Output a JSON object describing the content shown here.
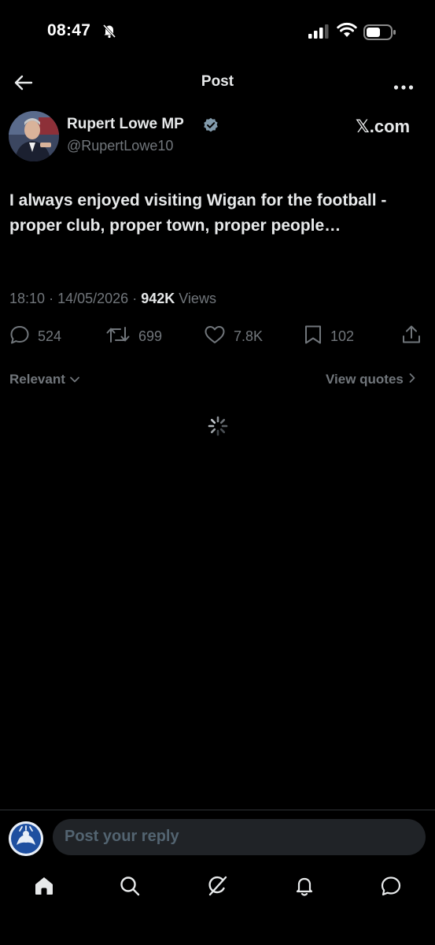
{
  "status_bar": {
    "time": "08:47"
  },
  "header": {
    "title": "Post"
  },
  "author": {
    "name": "Rupert Lowe MP",
    "handle": "@RupertLowe10",
    "source": "𝕏.com"
  },
  "tweet": {
    "text": "I always enjoyed visiting Wigan for the football - proper club, proper town, proper people…",
    "time": "18:10",
    "date": "14/05/2026",
    "views_count": "942K",
    "views_label": "Views"
  },
  "actions": {
    "replies": "524",
    "reposts": "699",
    "likes": "7.8K",
    "bookmarks": "102"
  },
  "sort": {
    "relevant": "Relevant",
    "view_quotes": "View quotes"
  },
  "reply": {
    "placeholder": "Post your reply"
  },
  "bottom_nav": [
    "home-icon",
    "search-icon",
    "grok-icon",
    "notifications-icon",
    "messages-icon"
  ],
  "colors": {
    "background": "#000000",
    "text": "#e7e9ea",
    "muted": "#71767b",
    "verified": "#829aab",
    "input_bg": "#202327"
  }
}
